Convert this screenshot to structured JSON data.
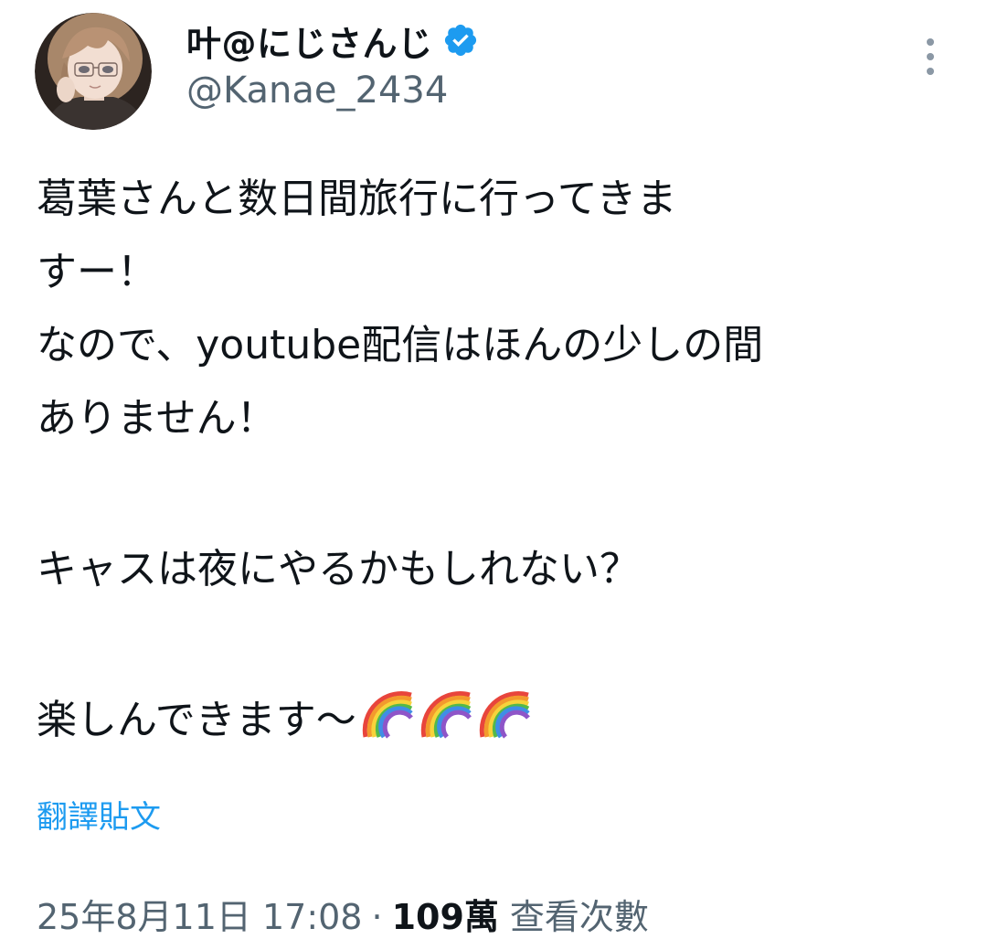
{
  "author": {
    "display_name": "叶@にじさんじ",
    "handle": "@Kanae_2434",
    "verified": true,
    "avatar_icon": "profile-avatar"
  },
  "tweet": {
    "lines": [
      "葛葉さんと数日間旅行に行ってきま",
      "すー！",
      "なので、youtube配信はほんの少しの間",
      "ありません！",
      "",
      "キャスは夜にやるかもしれない？",
      "",
      "楽しんできます〜"
    ],
    "trailing_emoji": [
      "rainbow",
      "rainbow",
      "rainbow"
    ]
  },
  "actions": {
    "translate_label": "翻譯貼文",
    "more_icon": "more-vertical-icon"
  },
  "meta": {
    "timestamp": "25年8月11日 17:08",
    "separator": "·",
    "views_count": "109萬",
    "views_label": "查看次數"
  },
  "colors": {
    "text": "#0f1419",
    "secondary": "#536471",
    "link": "#1d9bf0",
    "verified_badge": "#1d9bf0"
  }
}
